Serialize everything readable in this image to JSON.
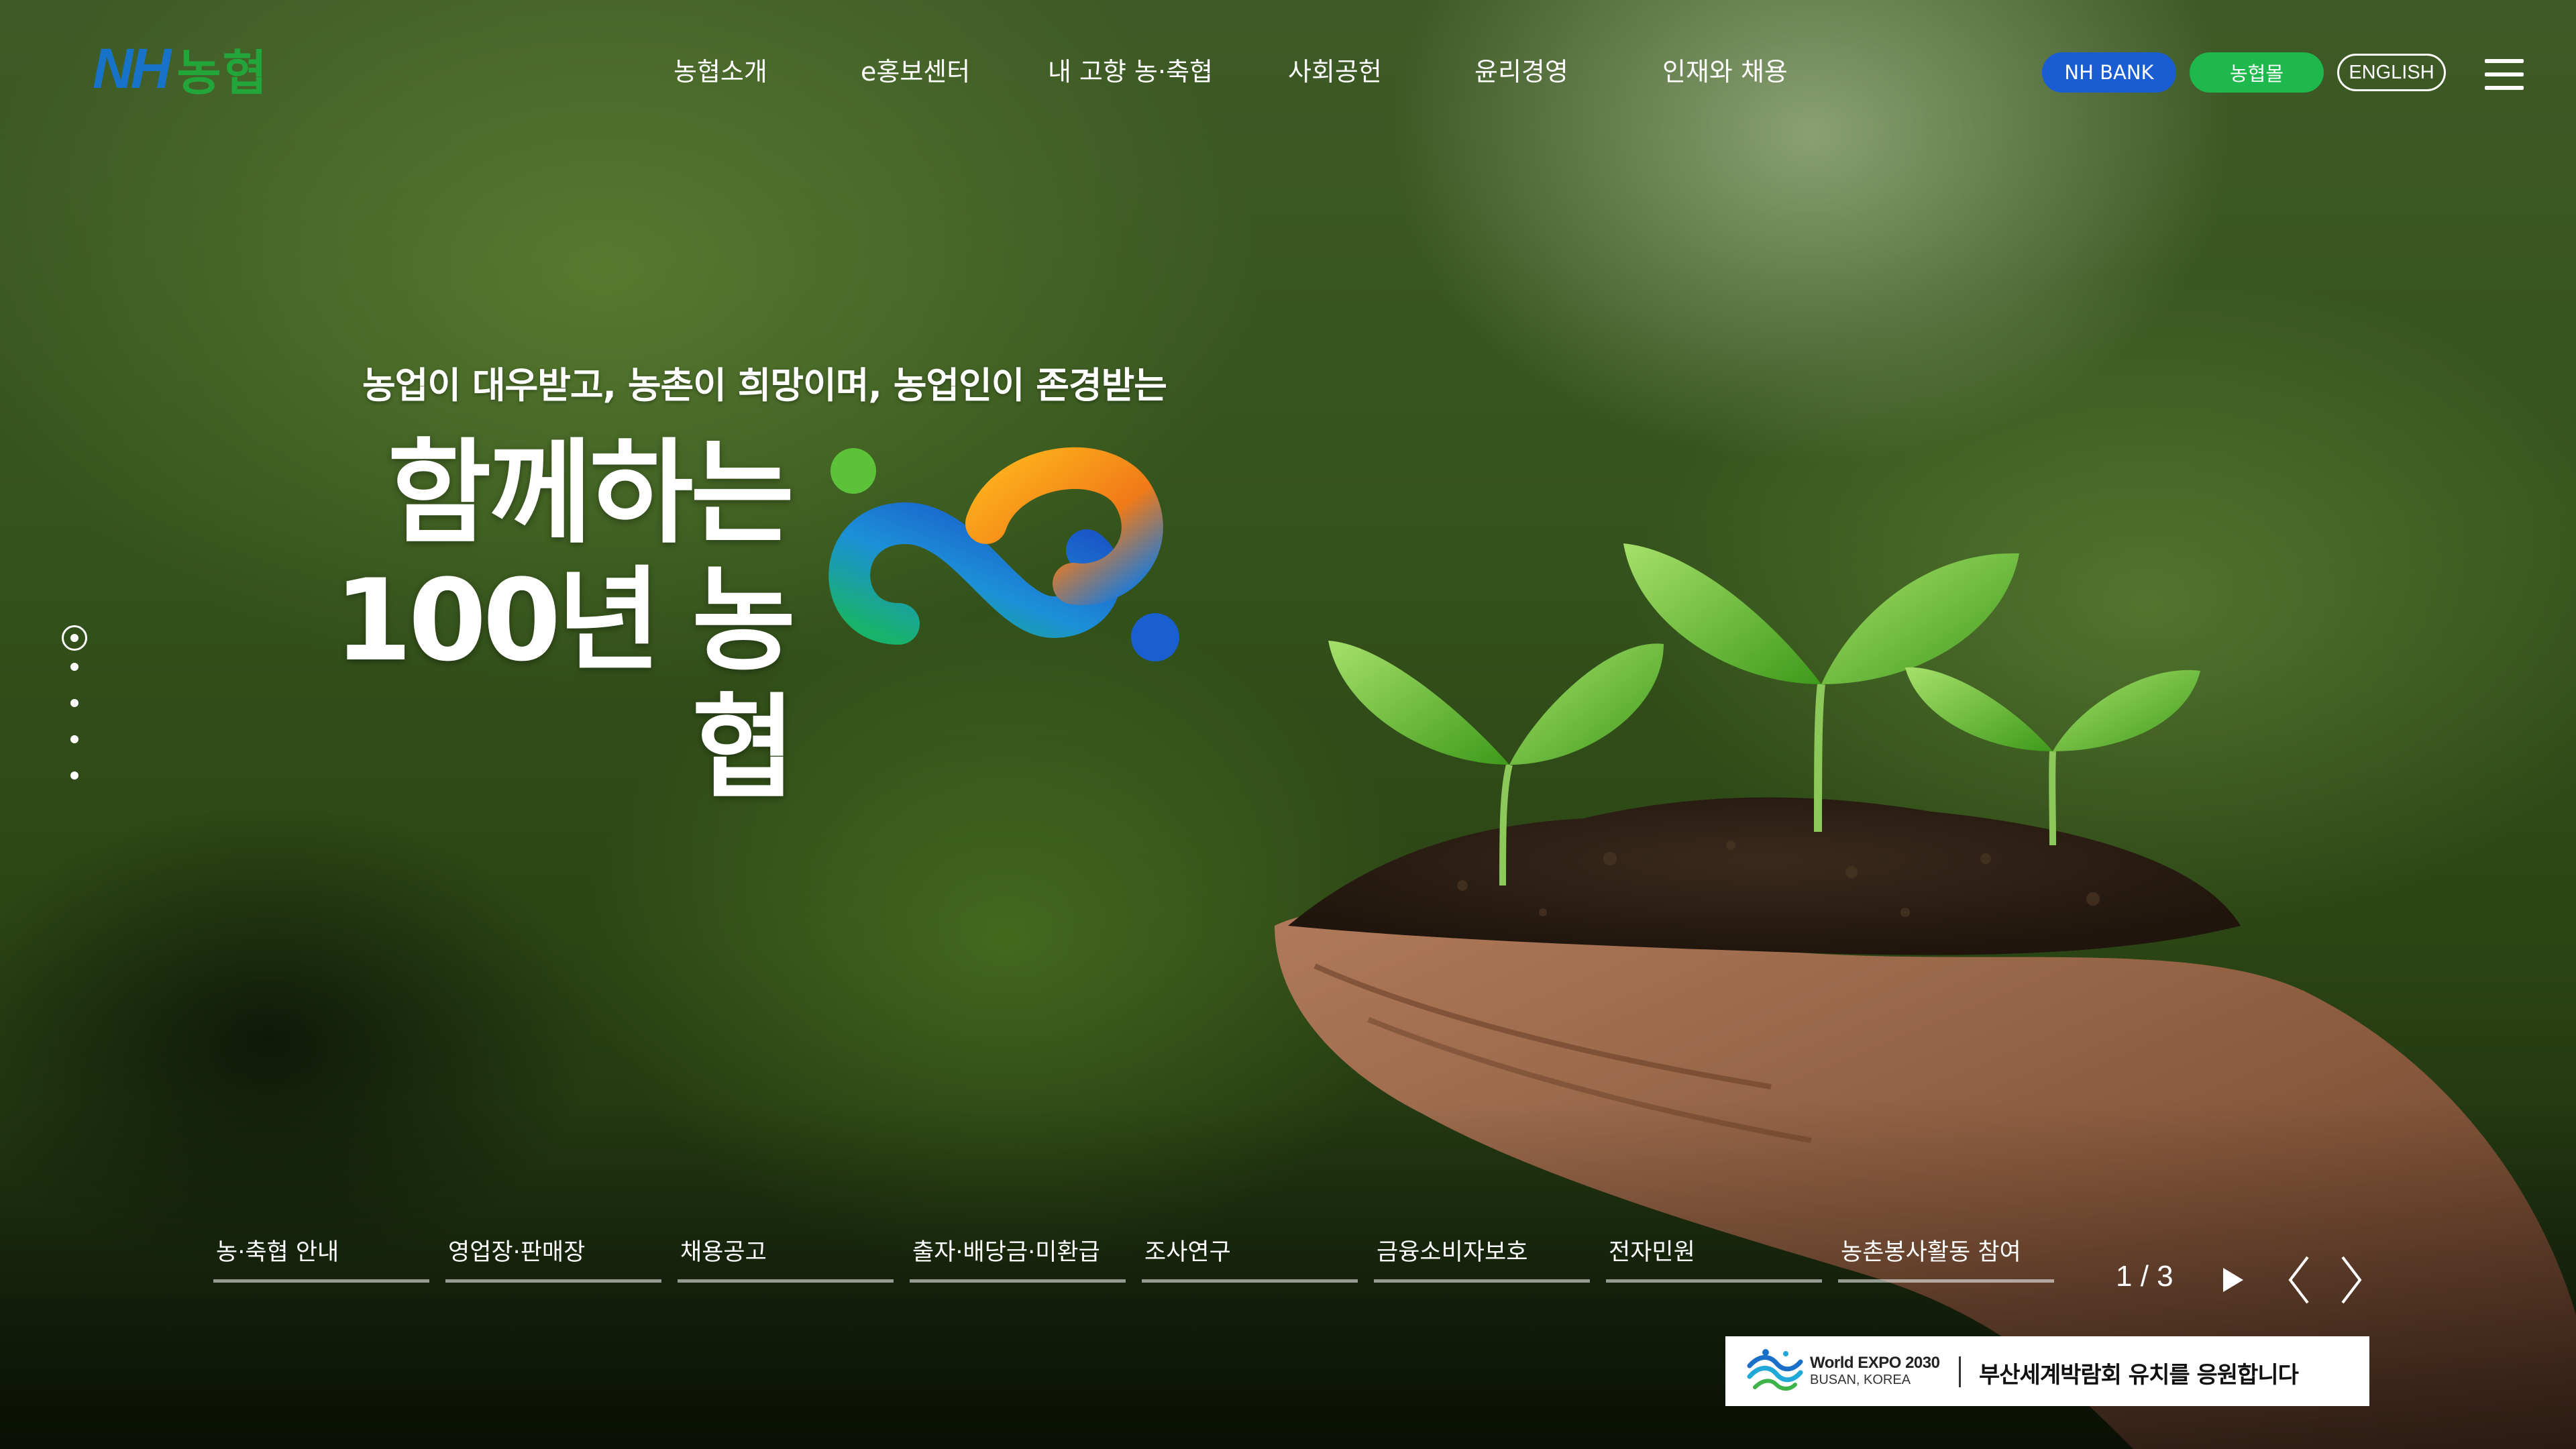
{
  "header": {
    "logo_nh": "NH",
    "logo_ko": "농협",
    "nav": [
      "농협소개",
      "e홍보센터",
      "내 고향 농·축협",
      "사회공헌",
      "윤리경영",
      "인재와 채용"
    ],
    "buttons": {
      "bank": "NH BANK",
      "mall": "농협몰",
      "english": "ENGLISH"
    }
  },
  "hero": {
    "slogan": "농업이 대우받고, 농촌이 희망이며, 농업인이 존경받는",
    "title_line1": "함께하는",
    "title_line2": "100년 농협"
  },
  "slides": {
    "current": 1,
    "total": 3,
    "counter_text": "1 / 3"
  },
  "quick_links": [
    "농·축협 안내",
    "영업장·판매장",
    "채용공고",
    "출자·배당금·미환급",
    "조사연구",
    "금융소비자보호",
    "전자민원",
    "농촌봉사활동 참여"
  ],
  "expo_banner": {
    "en_line1": "World EXPO 2030",
    "en_line2": "BUSAN, KOREA",
    "ko_text": "부산세계박람회 유치를 응원합니다"
  },
  "colors": {
    "bank_button": "#1a5dd3",
    "mall_button": "#1fb84c",
    "logo_blue": "#1673c9",
    "logo_green": "#22a63a"
  },
  "icons": [
    "menu-icon",
    "play-icon",
    "prev-arrow-icon",
    "next-arrow-icon",
    "expo-wave-icon"
  ]
}
